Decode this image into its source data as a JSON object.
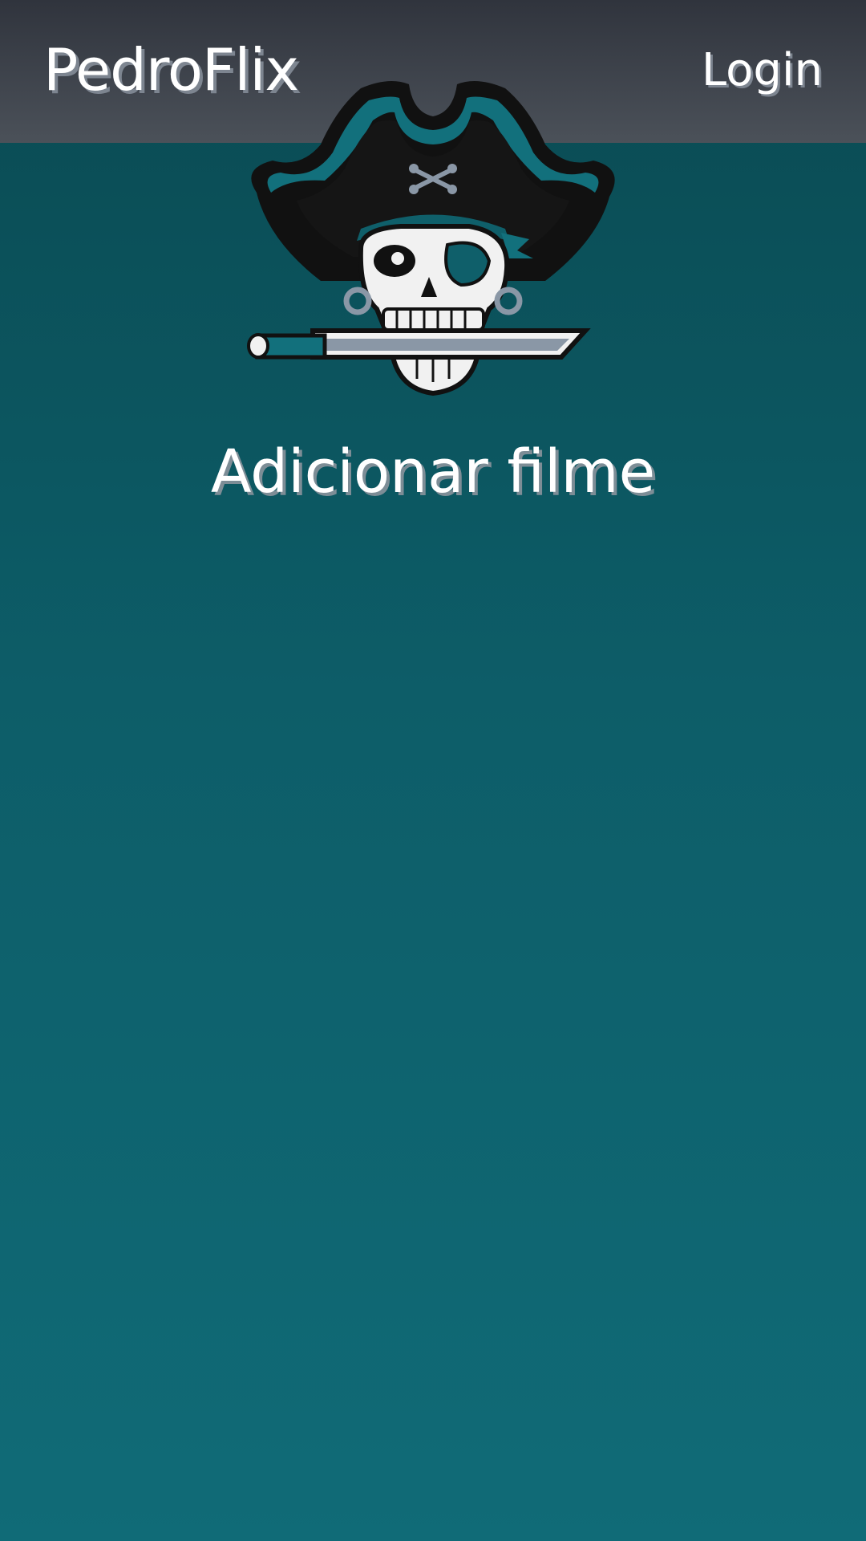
{
  "header": {
    "brand": "PedroFlix",
    "login_label": "Login"
  },
  "logo": {
    "icon": "pirate-skull-icon"
  },
  "main": {
    "title": "Adicionar filme"
  },
  "colors": {
    "navbar_top": "#30343d",
    "navbar_bottom": "#4b5159",
    "background_top": "#0a4a52",
    "background_bottom": "#106b77",
    "accent_teal": "#12707c"
  }
}
